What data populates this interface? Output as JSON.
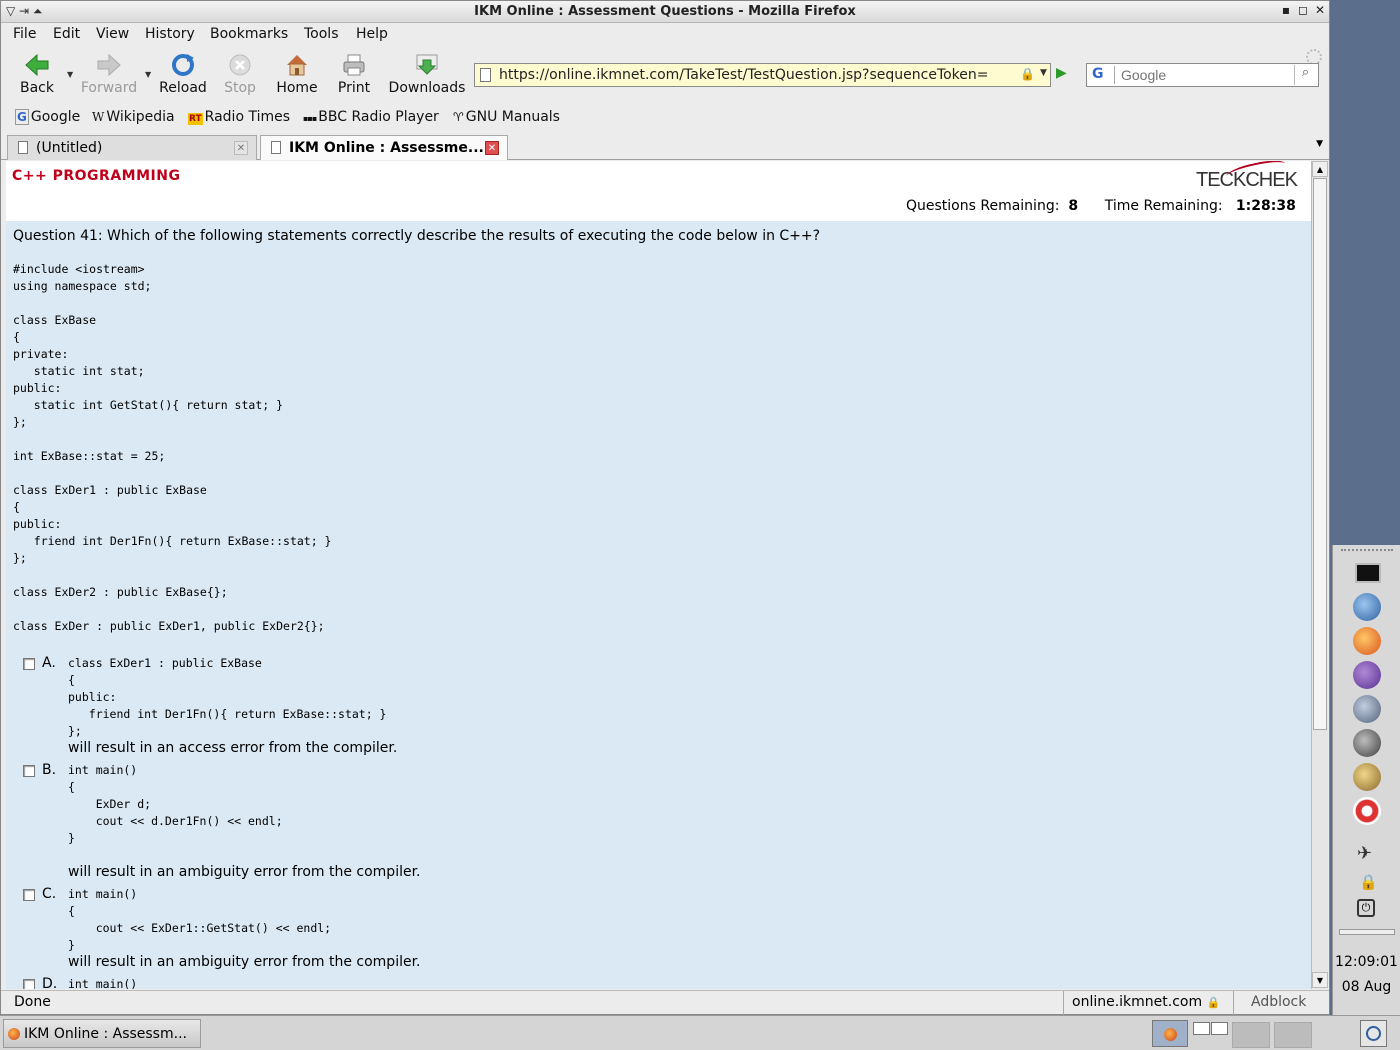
{
  "window": {
    "title": "IKM Online : Assessment Questions - Mozilla Firefox"
  },
  "menu": [
    "File",
    "Edit",
    "View",
    "History",
    "Bookmarks",
    "Tools",
    "Help"
  ],
  "nav": {
    "back": "Back",
    "forward": "Forward",
    "reload": "Reload",
    "stop": "Stop",
    "home": "Home",
    "print": "Print",
    "downloads": "Downloads"
  },
  "url": "https://online.ikmnet.com/TakeTest/TestQuestion.jsp?sequenceToken=",
  "search": {
    "engine": "G",
    "placeholder": "Google"
  },
  "bookmarks": [
    "Google",
    "Wikipedia",
    "Radio Times",
    "BBC Radio Player",
    "GNU Manuals"
  ],
  "tabs": [
    {
      "label": "(Untitled)"
    },
    {
      "label": "IKM Online : Assessme..."
    }
  ],
  "page": {
    "section": "C++ PROGRAMMING",
    "logo": "TECKCHEK",
    "remaining_label": "Questions Remaining:",
    "remaining_value": "8",
    "time_label": "Time Remaining:",
    "time_value": "1:28:38",
    "question": "Question 41: Which of the following statements correctly describe the results of executing the code below in C++?",
    "code": "#include <iostream>\nusing namespace std;\n\nclass ExBase\n{\nprivate:\n   static int stat;\npublic:\n   static int GetStat(){ return stat; }\n};\n\nint ExBase::stat = 25;\n\nclass ExDer1 : public ExBase\n{\npublic:\n   friend int Der1Fn(){ return ExBase::stat; }\n};\n\nclass ExDer2 : public ExBase{};\n\nclass ExDer : public ExDer1, public ExDer2{};",
    "options": [
      {
        "letter": "A.",
        "code": "class ExDer1 : public ExBase\n{\npublic:\n   friend int Der1Fn(){ return ExBase::stat; }\n};",
        "result": "will result in an access error from the compiler."
      },
      {
        "letter": "B.",
        "code": "int main()\n{\n    ExDer d;\n    cout << d.Der1Fn() << endl;\n}",
        "result": "will result in an ambiguity error from the compiler."
      },
      {
        "letter": "C.",
        "code": "int main()\n{\n    cout << ExDer1::GetStat() << endl;\n}",
        "result": "will result in an ambiguity error from the compiler."
      },
      {
        "letter": "D.",
        "code": "int main()",
        "result": ""
      }
    ]
  },
  "status": {
    "text": "Done",
    "host": "online.ikmnet.com",
    "adblock": "Adblock"
  },
  "taskbar": {
    "item": "IKM Online : Assessm..."
  },
  "clock": {
    "time": "12:09:01",
    "date": "08 Aug"
  }
}
